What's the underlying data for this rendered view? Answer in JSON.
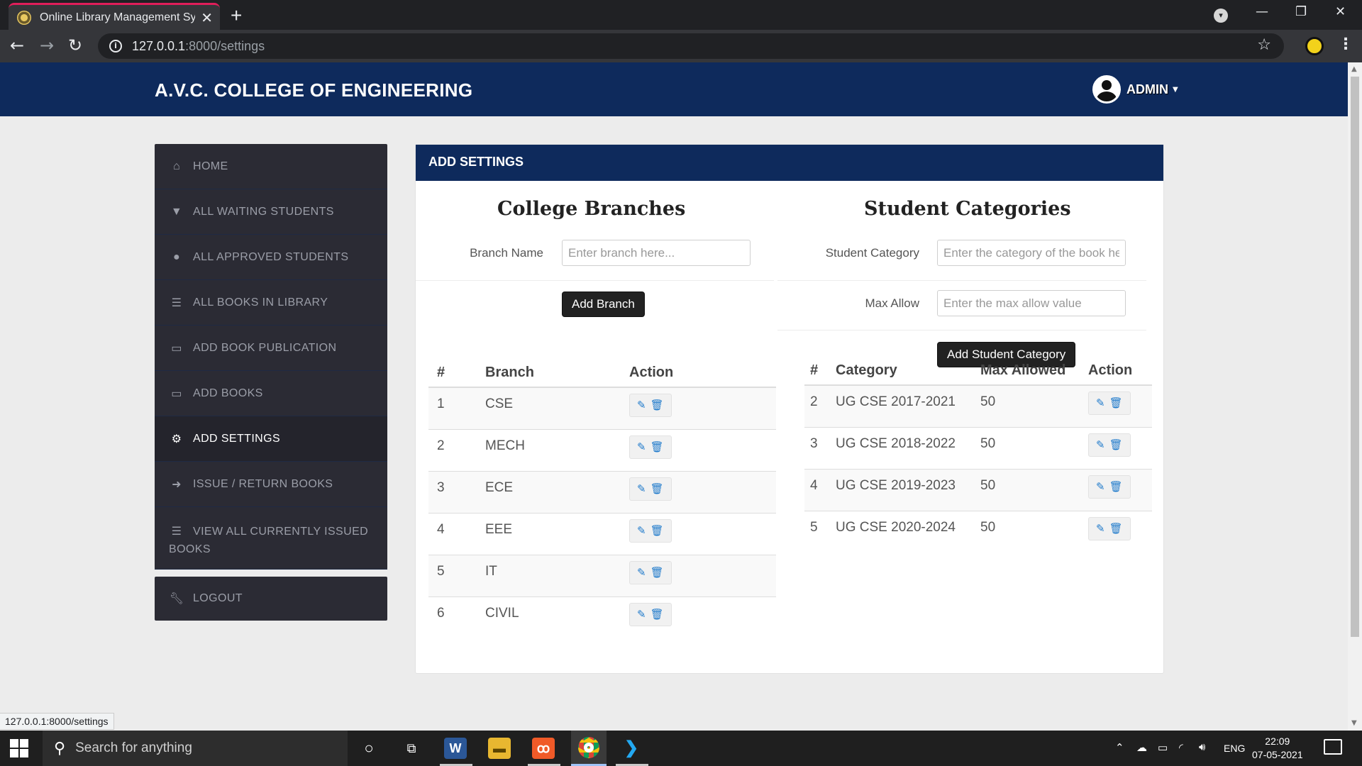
{
  "browser": {
    "tab_title": "Online Library Management System",
    "new_tab": "+",
    "tab_close": "✕",
    "url_host": "127.0.0.1",
    "url_path": ":8000/settings",
    "status_url": "127.0.0.1:8000/settings"
  },
  "navbar": {
    "brand": "A.V.C. COLLEGE OF ENGINEERING",
    "user": "ADMIN"
  },
  "sidebar": {
    "items": [
      {
        "label": "HOME",
        "icon": "home-icon"
      },
      {
        "label": "ALL WAITING STUDENTS",
        "icon": "filter-icon"
      },
      {
        "label": "ALL APPROVED STUDENTS",
        "icon": "users-icon"
      },
      {
        "label": "ALL BOOKS IN LIBRARY",
        "icon": "list-icon"
      },
      {
        "label": "ADD BOOK PUBLICATION",
        "icon": "folder-icon"
      },
      {
        "label": "ADD BOOKS",
        "icon": "folder-icon"
      },
      {
        "label": "ADD SETTINGS",
        "icon": "gear-icon",
        "active": true
      },
      {
        "label": "ISSUE / RETURN BOOKS",
        "icon": "sign-out-icon"
      },
      {
        "label": "VIEW ALL CURRENTLY ISSUED BOOKS",
        "icon": "list-icon"
      }
    ],
    "logout": "LOGOUT"
  },
  "panel": {
    "title": "ADD SETTINGS",
    "branches": {
      "title": "College Branches",
      "label": "Branch Name",
      "placeholder": "Enter branch here...",
      "button": "Add Branch",
      "columns": [
        "#",
        "Branch",
        "Action"
      ],
      "rows": [
        {
          "num": "1",
          "name": "CSE"
        },
        {
          "num": "2",
          "name": "MECH"
        },
        {
          "num": "3",
          "name": "ECE"
        },
        {
          "num": "4",
          "name": "EEE"
        },
        {
          "num": "5",
          "name": "IT"
        },
        {
          "num": "6",
          "name": "CIVIL"
        }
      ]
    },
    "categories": {
      "title": "Student Categories",
      "category_label": "Student Category",
      "category_placeholder": "Enter the category of the book here...",
      "max_label": "Max Allow",
      "max_placeholder": "Enter the max allow value",
      "button": "Add Student Category",
      "columns": [
        "#",
        "Category",
        "Max Allowed",
        "Action"
      ],
      "rows": [
        {
          "num": "2",
          "name": "UG CSE 2017-2021",
          "max": "50"
        },
        {
          "num": "3",
          "name": "UG CSE 2018-2022",
          "max": "50"
        },
        {
          "num": "4",
          "name": "UG CSE 2019-2023",
          "max": "50"
        },
        {
          "num": "5",
          "name": "UG CSE 2020-2024",
          "max": "50"
        }
      ]
    }
  },
  "taskbar": {
    "search_placeholder": "Search for anything",
    "language": "ENG",
    "time": "22:09",
    "date": "07-05-2021"
  },
  "colors": {
    "navy": "#0e2a5c",
    "sidebar": "#2b2b34",
    "action_blue": "#1f7acb"
  }
}
